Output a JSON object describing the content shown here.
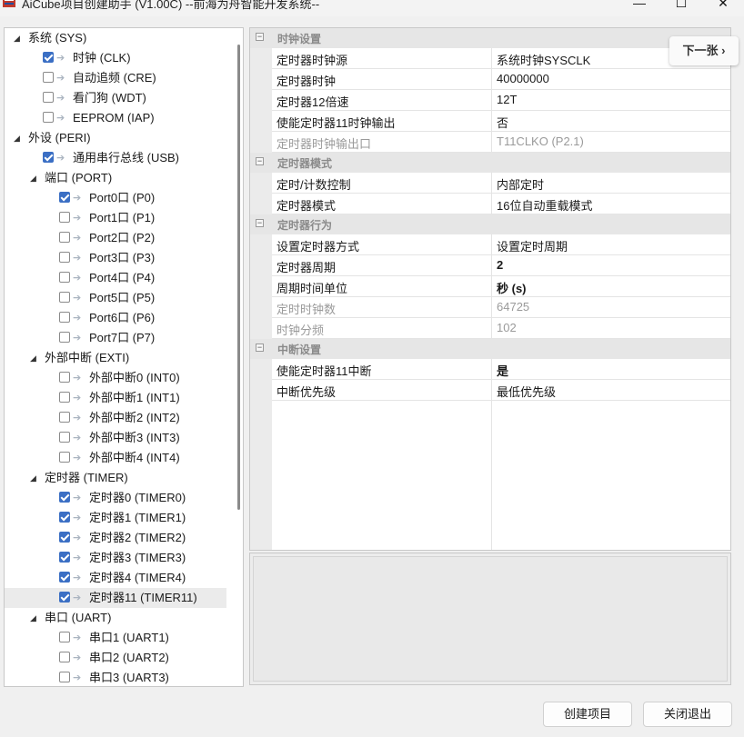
{
  "window": {
    "title": "AiCube项目创建助手 (V1.00C) --前海为舟智能开发系统--",
    "minimize": "—",
    "maximize": "☐",
    "close": "✕"
  },
  "tree": [
    {
      "level": 0,
      "expander": "◢",
      "label": "系统 (SYS)"
    },
    {
      "level": 1,
      "checked": true,
      "label": "时钟 (CLK)"
    },
    {
      "level": 1,
      "checked": false,
      "label": "自动追频 (CRE)"
    },
    {
      "level": 1,
      "checked": false,
      "label": "看门狗 (WDT)"
    },
    {
      "level": 1,
      "checked": false,
      "label": "EEPROM (IAP)"
    },
    {
      "level": 0,
      "expander": "◢",
      "label": "外设 (PERI)"
    },
    {
      "level": 1,
      "checked": true,
      "label": "通用串行总线 (USB)"
    },
    {
      "level": 1,
      "expander": "◢",
      "label": "端口 (PORT)"
    },
    {
      "level": 2,
      "checked": true,
      "label": "Port0口 (P0)"
    },
    {
      "level": 2,
      "checked": false,
      "label": "Port1口 (P1)"
    },
    {
      "level": 2,
      "checked": false,
      "label": "Port2口 (P2)"
    },
    {
      "level": 2,
      "checked": false,
      "label": "Port3口 (P3)"
    },
    {
      "level": 2,
      "checked": false,
      "label": "Port4口 (P4)"
    },
    {
      "level": 2,
      "checked": false,
      "label": "Port5口 (P5)"
    },
    {
      "level": 2,
      "checked": false,
      "label": "Port6口 (P6)"
    },
    {
      "level": 2,
      "checked": false,
      "label": "Port7口 (P7)"
    },
    {
      "level": 1,
      "expander": "◢",
      "label": "外部中断 (EXTI)"
    },
    {
      "level": 2,
      "checked": false,
      "label": "外部中断0 (INT0)"
    },
    {
      "level": 2,
      "checked": false,
      "label": "外部中断1 (INT1)"
    },
    {
      "level": 2,
      "checked": false,
      "label": "外部中断2 (INT2)"
    },
    {
      "level": 2,
      "checked": false,
      "label": "外部中断3 (INT3)"
    },
    {
      "level": 2,
      "checked": false,
      "label": "外部中断4 (INT4)"
    },
    {
      "level": 1,
      "expander": "◢",
      "label": "定时器 (TIMER)"
    },
    {
      "level": 2,
      "checked": true,
      "label": "定时器0 (TIMER0)"
    },
    {
      "level": 2,
      "checked": true,
      "label": "定时器1 (TIMER1)"
    },
    {
      "level": 2,
      "checked": true,
      "label": "定时器2 (TIMER2)"
    },
    {
      "level": 2,
      "checked": true,
      "label": "定时器3 (TIMER3)"
    },
    {
      "level": 2,
      "checked": true,
      "label": "定时器4 (TIMER4)"
    },
    {
      "level": 2,
      "checked": true,
      "selected": true,
      "label": "定时器11 (TIMER11)"
    },
    {
      "level": 1,
      "expander": "◢",
      "label": "串口 (UART)"
    },
    {
      "level": 2,
      "checked": false,
      "label": "串口1 (UART1)"
    },
    {
      "level": 2,
      "checked": false,
      "label": "串口2 (UART2)"
    },
    {
      "level": 2,
      "checked": false,
      "label": "串口3 (UART3)"
    }
  ],
  "grid": [
    {
      "category": "时钟设置",
      "toggle": "⊟"
    },
    {
      "name": "定时器时钟源",
      "value": "系统时钟SYSCLK"
    },
    {
      "name": "定时器时钟",
      "value": "40000000"
    },
    {
      "name": "定时器12倍速",
      "value": "12T"
    },
    {
      "name": "使能定时器11时钟输出",
      "value": "否"
    },
    {
      "name": "定时器时钟输出口",
      "value": "T11CLKO (P2.1)",
      "disabled": true
    },
    {
      "category": "定时器模式",
      "toggle": "⊟"
    },
    {
      "name": "定时/计数控制",
      "value": "内部定时"
    },
    {
      "name": "定时器模式",
      "value": "16位自动重载模式"
    },
    {
      "category": "定时器行为",
      "toggle": "⊟"
    },
    {
      "name": "设置定时器方式",
      "value": "设置定时周期"
    },
    {
      "name": "定时器周期",
      "value": "2",
      "bold": true
    },
    {
      "name": "周期时间单位",
      "value": "秒 (s)",
      "bold": true
    },
    {
      "name": "定时时钟数",
      "value": "64725",
      "disabled": true
    },
    {
      "name": "时钟分频",
      "value": "102",
      "disabled": true
    },
    {
      "category": "中断设置",
      "toggle": "⊟"
    },
    {
      "name": "使能定时器11中断",
      "value": "是",
      "bold": true
    },
    {
      "name": "中断优先级",
      "value": "最低优先级"
    }
  ],
  "next_button": "下一张 ›",
  "buttons": {
    "create": "创建项目",
    "exit": "关闭退出"
  }
}
